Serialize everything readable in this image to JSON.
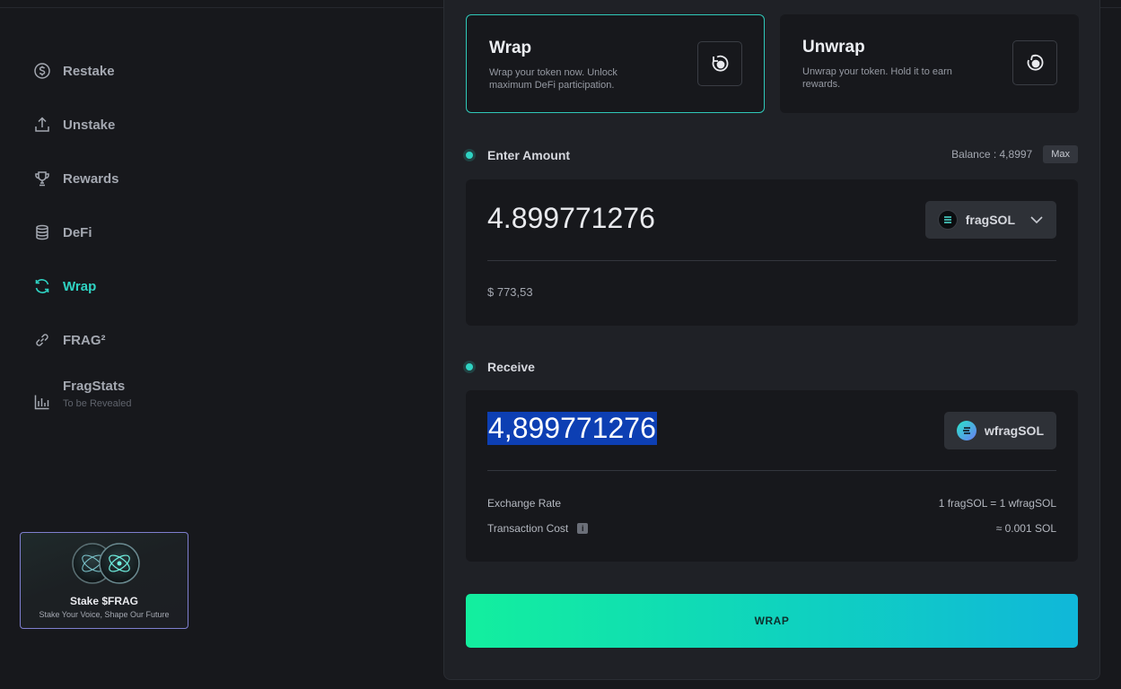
{
  "sidebar": {
    "items": [
      {
        "label": "Restake",
        "icon": "dollar-circle-icon"
      },
      {
        "label": "Unstake",
        "icon": "upload-icon"
      },
      {
        "label": "Rewards",
        "icon": "trophy-icon"
      },
      {
        "label": "DeFi",
        "icon": "database-icon"
      },
      {
        "label": "Wrap",
        "icon": "refresh-icon",
        "active": true
      },
      {
        "label": "FRAG²",
        "icon": "link-icon"
      },
      {
        "label": "FragStats",
        "icon": "bar-chart-icon",
        "sub": "To be Revealed"
      }
    ],
    "active_color": "#2fd3c3"
  },
  "promo": {
    "title": "Stake $FRAG",
    "subtitle": "Stake Your Voice, Shape Our Future"
  },
  "modes": {
    "wrap": {
      "title": "Wrap",
      "desc": "Wrap your token now. Unlock maximum DeFi participation."
    },
    "unwrap": {
      "title": "Unwrap",
      "desc": "Unwrap your token. Hold it to earn rewards."
    }
  },
  "enter": {
    "label": "Enter Amount",
    "balance": "Balance : 4,8997",
    "max_label": "Max",
    "amount": "4.899771276",
    "token": "fragSOL",
    "usd": "$ 773,53"
  },
  "receive": {
    "label": "Receive",
    "amount": "4,899771276",
    "token": "wfragSOL",
    "exchange_label": "Exchange Rate",
    "exchange_value": "1 fragSOL = 1 wfragSOL",
    "cost_label": "Transaction Cost",
    "cost_value": "≈ 0.001 SOL"
  },
  "action": {
    "label": "WRAP"
  },
  "colors": {
    "accent": "#2fd3c3",
    "button_start": "#13ef9e",
    "button_end": "#10b7d9"
  }
}
